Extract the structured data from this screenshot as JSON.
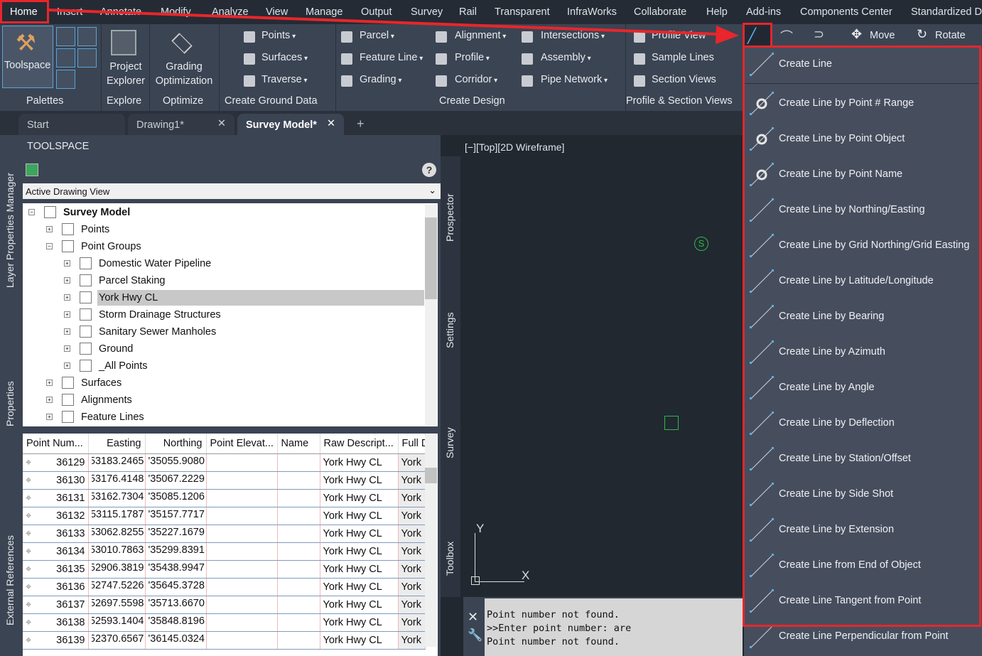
{
  "menubar": {
    "tabs": [
      "Home",
      "Insert",
      "Annotate",
      "Modify",
      "Analyze",
      "View",
      "Manage",
      "Output",
      "Survey",
      "Rail",
      "Transparent",
      "InfraWorks",
      "Collaborate",
      "Help",
      "Add-ins",
      "Components Center",
      "Standardized D"
    ],
    "active": "Home"
  },
  "ribbon": {
    "palettes": {
      "toolspace": "Toolspace",
      "label": "Palettes"
    },
    "explore": {
      "button": "Project Explorer",
      "label": "Explore"
    },
    "optimize": {
      "button": "Grading Optimization",
      "label": "Optimize"
    },
    "ground": {
      "items": [
        "Points",
        "Surfaces",
        "Traverse"
      ],
      "label": "Create Ground Data"
    },
    "design": {
      "col1": [
        "Parcel",
        "Feature Line",
        "Grading"
      ],
      "col2": [
        "Alignment",
        "Profile",
        "Corridor"
      ],
      "col3": [
        "Intersections",
        "Assembly",
        "Pipe Network"
      ],
      "label": "Create Design"
    },
    "views": {
      "items": [
        "Profile View",
        "Sample Lines",
        "Section Views"
      ],
      "label": "Profile & Section Views"
    },
    "draw": {
      "move": "Move",
      "rotate": "Rotate"
    }
  },
  "doc_tabs": [
    "Start",
    "Drawing1*",
    "Survey Model*"
  ],
  "left_strip": [
    "Layer Properties Manager",
    "Properties",
    "External References"
  ],
  "toolspace": {
    "title": "TOOLSPACE",
    "view_select": "Active Drawing View",
    "tree": [
      {
        "label": "Survey Model",
        "level": 0,
        "bold": true
      },
      {
        "label": "Points",
        "level": 1
      },
      {
        "label": "Point Groups",
        "level": 1
      },
      {
        "label": "Domestic Water Pipeline",
        "level": 2
      },
      {
        "label": "Parcel Staking",
        "level": 2
      },
      {
        "label": "York Hwy CL",
        "level": 2,
        "selected": true
      },
      {
        "label": "Storm Drainage Structures",
        "level": 2
      },
      {
        "label": "Sanitary Sewer Manholes",
        "level": 2
      },
      {
        "label": "Ground",
        "level": 2
      },
      {
        "label": "_All Points",
        "level": 2
      },
      {
        "label": "Surfaces",
        "level": 1
      },
      {
        "label": "Alignments",
        "level": 1
      },
      {
        "label": "Feature Lines",
        "level": 1
      }
    ],
    "columns": [
      "Point Num...",
      "Easting",
      "Northing",
      "Point Elevat...",
      "Name",
      "Raw Descript...",
      "Full D"
    ],
    "rows": [
      [
        "36129",
        "53183.2465'",
        "35055.9080'",
        "",
        "",
        "York Hwy CL",
        "York"
      ],
      [
        "36130",
        "53176.4148'",
        "35067.2229'",
        "",
        "",
        "York Hwy CL",
        "York"
      ],
      [
        "36131",
        "53162.7304'",
        "35085.1206'",
        "",
        "",
        "York Hwy CL",
        "York"
      ],
      [
        "36132",
        "53115.1787'",
        "35157.7717'",
        "",
        "",
        "York Hwy CL",
        "York"
      ],
      [
        "36133",
        "53062.8255'",
        "35227.1679'",
        "",
        "",
        "York Hwy CL",
        "York"
      ],
      [
        "36134",
        "53010.7863'",
        "35299.8391'",
        "",
        "",
        "York Hwy CL",
        "York"
      ],
      [
        "36135",
        "52906.3819'",
        "35438.9947'",
        "",
        "",
        "York Hwy CL",
        "York"
      ],
      [
        "36136",
        "52747.5226'",
        "35645.3728'",
        "",
        "",
        "York Hwy CL",
        "York"
      ],
      [
        "36137",
        "52697.5598'",
        "35713.6670'",
        "",
        "",
        "York Hwy CL",
        "York"
      ],
      [
        "36138",
        "52593.1404'",
        "35848.8196'",
        "",
        "",
        "York Hwy CL",
        "York"
      ],
      [
        "36139",
        "52370.6567'",
        "36145.0324'",
        "",
        "",
        "York Hwy CL",
        "York"
      ]
    ]
  },
  "side_tabs": [
    "Prospector",
    "Settings",
    "Survey",
    "Toolbox"
  ],
  "viewport": {
    "label": "[−][Top][2D Wireframe]",
    "ucs_x": "X",
    "ucs_y": "Y",
    "marker": "S"
  },
  "command": {
    "lines": [
      "Point number not found.",
      ">>Enter point number: are",
      "Point number not found."
    ]
  },
  "dropdown": {
    "items": [
      "Create Line",
      "Create Line by Point # Range",
      "Create Line by Point Object",
      "Create Line by Point Name",
      "Create Line by Northing/Easting",
      "Create Line by Grid Northing/Grid Easting",
      "Create Line by Latitude/Longitude",
      "Create Line by Bearing",
      "Create Line by Azimuth",
      "Create Line by Angle",
      "Create Line by Deflection",
      "Create Line by Station/Offset",
      "Create Line by Side Shot",
      "Create Line by Extension",
      "Create Line from End of Object",
      "Create Line Tangent from Point",
      "Create Line Perpendicular from Point"
    ]
  },
  "colors": {
    "annotation": "#e8262b",
    "ribbon": "#3b4453",
    "selected_row": "#c8c8c8"
  }
}
